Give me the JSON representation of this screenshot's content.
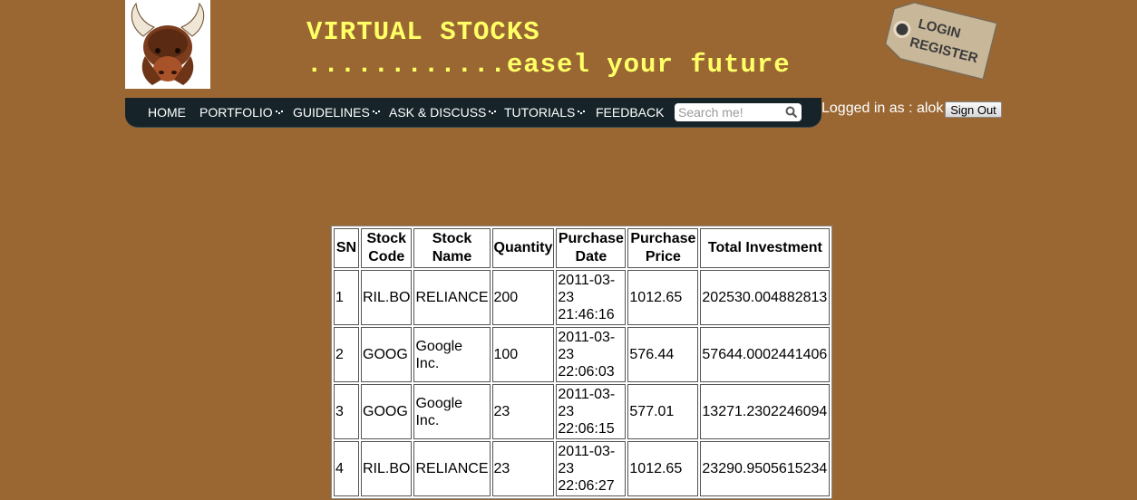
{
  "header": {
    "title": "VIRTUAL STOCKS",
    "tagline": "............easel your future",
    "tag_login": "LOGIN",
    "tag_register": "REGISTER"
  },
  "nav": {
    "items": [
      {
        "label": "HOME",
        "has_dropdown": false
      },
      {
        "label": "PORTFOLIO",
        "has_dropdown": true
      },
      {
        "label": "GUIDELINES",
        "has_dropdown": true
      },
      {
        "label": "ASK & DISCUSS",
        "has_dropdown": true
      },
      {
        "label": "TUTORIALS",
        "has_dropdown": true
      },
      {
        "label": "FEEDBACK",
        "has_dropdown": false
      }
    ],
    "search_placeholder": "Search me!"
  },
  "user": {
    "logged_in_text": "Logged in as : alok",
    "sign_out_label": "Sign Out"
  },
  "table": {
    "headers": [
      "SN",
      "Stock Code",
      "Stock Name",
      "Quantity",
      "Purchase Date",
      "Purchase Price",
      "Total Investment"
    ],
    "rows": [
      [
        "1",
        "RIL.BO",
        "RELIANCE",
        "200",
        "2011-03-23 21:46:16",
        "1012.65",
        "202530.004882813"
      ],
      [
        "2",
        "GOOG",
        "Google Inc.",
        "100",
        "2011-03-23 22:06:03",
        "576.44",
        "57644.0002441406"
      ],
      [
        "3",
        "GOOG",
        "Google Inc.",
        "23",
        "2011-03-23 22:06:15",
        "577.01",
        "13271.2302246094"
      ],
      [
        "4",
        "RIL.BO",
        "RELIANCE",
        "23",
        "2011-03-23 22:06:27",
        "1012.65",
        "23290.9505615234"
      ]
    ]
  },
  "colors": {
    "page_background": "#9a6733",
    "title_yellow": "#ffff66",
    "nav_background": "#16242a"
  }
}
